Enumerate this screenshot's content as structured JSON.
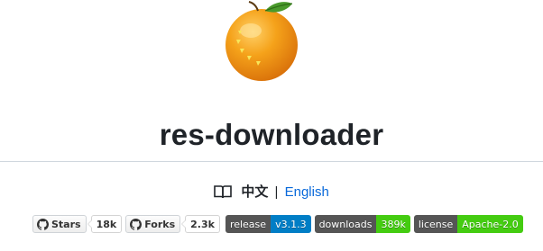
{
  "logo": {
    "icon": "orange-fruit-icon",
    "colors": {
      "peel": "#f5a21a",
      "peel_dark": "#e07b0a",
      "leaf": "#4a9a2c",
      "mark": "#f7e65a"
    }
  },
  "title": "res-downloader",
  "languages": {
    "icon": "book-icon",
    "current": "中文",
    "separator": "|",
    "other": "English",
    "link_color": "#0969da"
  },
  "badges": {
    "stars": {
      "label": "Stars",
      "count": "18k",
      "icon": "github-icon"
    },
    "forks": {
      "label": "Forks",
      "count": "2.3k",
      "icon": "github-icon"
    },
    "release": {
      "label": "release",
      "value": "v3.1.3",
      "color": "#007ec6"
    },
    "downloads": {
      "label": "downloads",
      "value": "389k",
      "color": "#4c1"
    },
    "license": {
      "label": "license",
      "value": "Apache-2.0",
      "color": "#4c1"
    }
  }
}
